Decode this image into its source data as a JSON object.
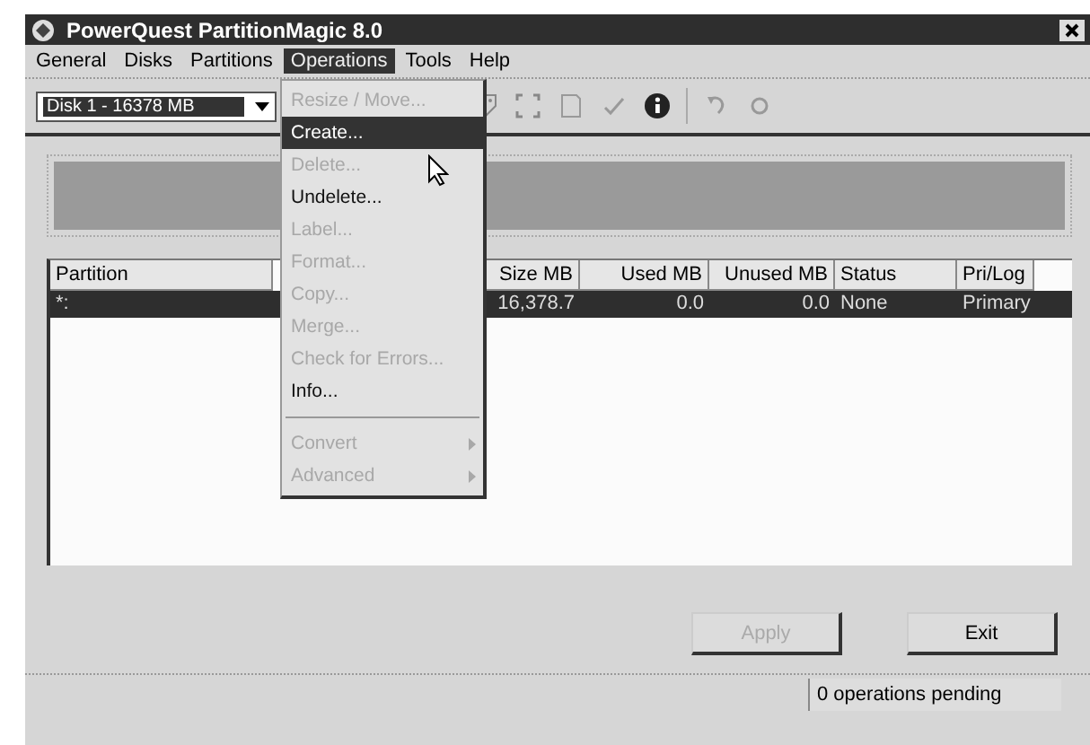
{
  "window": {
    "title": "PowerQuest PartitionMagic 8.0"
  },
  "menu_bar": [
    {
      "label": "General",
      "selected": false
    },
    {
      "label": "Disks",
      "selected": false
    },
    {
      "label": "Partitions",
      "selected": false
    },
    {
      "label": "Operations",
      "selected": true
    },
    {
      "label": "Tools",
      "selected": false
    },
    {
      "label": "Help",
      "selected": false
    }
  ],
  "disk_selector": {
    "value": "Disk 1 - 16378  MB"
  },
  "operations_menu": [
    {
      "kind": "item",
      "label": "Resize / Move...",
      "disabled": true,
      "selected": false
    },
    {
      "kind": "item",
      "label": "Create...",
      "disabled": false,
      "selected": true
    },
    {
      "kind": "item",
      "label": "Delete...",
      "disabled": true,
      "selected": false
    },
    {
      "kind": "item",
      "label": "Undelete...",
      "disabled": false,
      "selected": false
    },
    {
      "kind": "item",
      "label": "Label...",
      "disabled": true,
      "selected": false
    },
    {
      "kind": "item",
      "label": "Format...",
      "disabled": true,
      "selected": false
    },
    {
      "kind": "item",
      "label": "Copy...",
      "disabled": true,
      "selected": false
    },
    {
      "kind": "item",
      "label": "Merge...",
      "disabled": true,
      "selected": false
    },
    {
      "kind": "item",
      "label": "Check for Errors...",
      "disabled": true,
      "selected": false
    },
    {
      "kind": "item",
      "label": "Info...",
      "disabled": false,
      "selected": false
    },
    {
      "kind": "separator"
    },
    {
      "kind": "submenu",
      "label": "Convert",
      "disabled": true,
      "selected": false
    },
    {
      "kind": "submenu",
      "label": "Advanced",
      "disabled": true,
      "selected": false
    }
  ],
  "table": {
    "columns": [
      "Partition",
      "Size MB",
      "Used MB",
      "Unused MB",
      "Status",
      "Pri/Log"
    ],
    "rows": [
      {
        "cells": [
          "*:",
          "16,378.7",
          "0.0",
          "0.0",
          "None",
          "Primary"
        ],
        "selected": true
      }
    ]
  },
  "buttons": [
    {
      "label": "Apply",
      "disabled": true
    },
    {
      "label": "Exit",
      "disabled": false
    }
  ],
  "status_bar": {
    "text": "0 operations pending"
  }
}
